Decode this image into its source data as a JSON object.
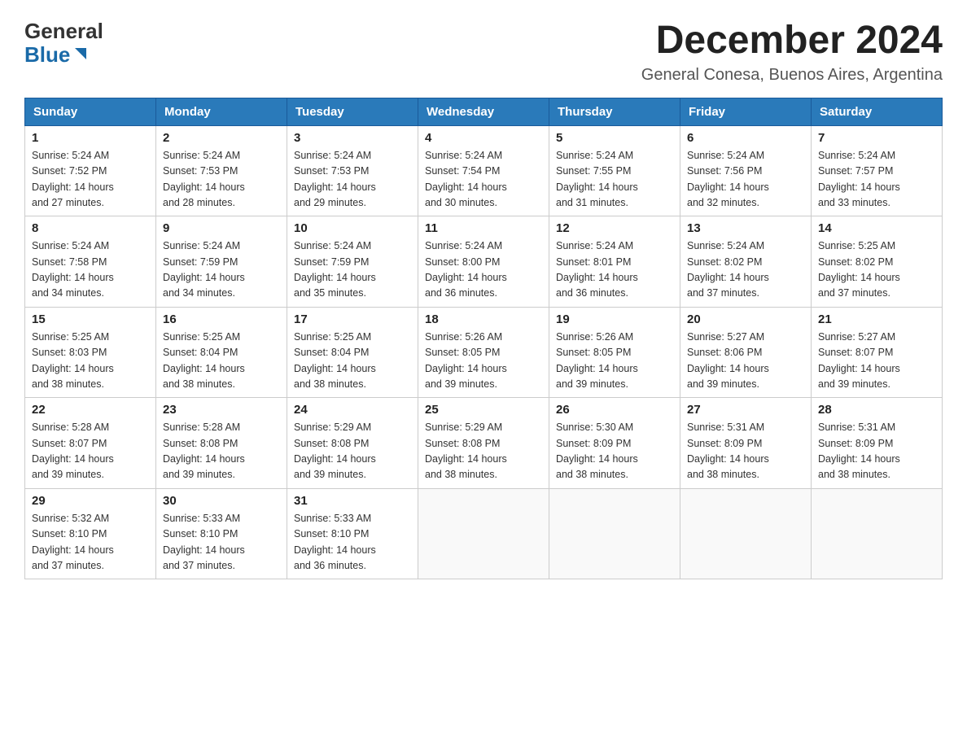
{
  "logo": {
    "general": "General",
    "blue": "Blue"
  },
  "header": {
    "month_year": "December 2024",
    "location": "General Conesa, Buenos Aires, Argentina"
  },
  "days_of_week": [
    "Sunday",
    "Monday",
    "Tuesday",
    "Wednesday",
    "Thursday",
    "Friday",
    "Saturday"
  ],
  "weeks": [
    [
      {
        "day": "1",
        "sunrise": "5:24 AM",
        "sunset": "7:52 PM",
        "daylight": "14 hours and 27 minutes."
      },
      {
        "day": "2",
        "sunrise": "5:24 AM",
        "sunset": "7:53 PM",
        "daylight": "14 hours and 28 minutes."
      },
      {
        "day": "3",
        "sunrise": "5:24 AM",
        "sunset": "7:53 PM",
        "daylight": "14 hours and 29 minutes."
      },
      {
        "day": "4",
        "sunrise": "5:24 AM",
        "sunset": "7:54 PM",
        "daylight": "14 hours and 30 minutes."
      },
      {
        "day": "5",
        "sunrise": "5:24 AM",
        "sunset": "7:55 PM",
        "daylight": "14 hours and 31 minutes."
      },
      {
        "day": "6",
        "sunrise": "5:24 AM",
        "sunset": "7:56 PM",
        "daylight": "14 hours and 32 minutes."
      },
      {
        "day": "7",
        "sunrise": "5:24 AM",
        "sunset": "7:57 PM",
        "daylight": "14 hours and 33 minutes."
      }
    ],
    [
      {
        "day": "8",
        "sunrise": "5:24 AM",
        "sunset": "7:58 PM",
        "daylight": "14 hours and 34 minutes."
      },
      {
        "day": "9",
        "sunrise": "5:24 AM",
        "sunset": "7:59 PM",
        "daylight": "14 hours and 34 minutes."
      },
      {
        "day": "10",
        "sunrise": "5:24 AM",
        "sunset": "7:59 PM",
        "daylight": "14 hours and 35 minutes."
      },
      {
        "day": "11",
        "sunrise": "5:24 AM",
        "sunset": "8:00 PM",
        "daylight": "14 hours and 36 minutes."
      },
      {
        "day": "12",
        "sunrise": "5:24 AM",
        "sunset": "8:01 PM",
        "daylight": "14 hours and 36 minutes."
      },
      {
        "day": "13",
        "sunrise": "5:24 AM",
        "sunset": "8:02 PM",
        "daylight": "14 hours and 37 minutes."
      },
      {
        "day": "14",
        "sunrise": "5:25 AM",
        "sunset": "8:02 PM",
        "daylight": "14 hours and 37 minutes."
      }
    ],
    [
      {
        "day": "15",
        "sunrise": "5:25 AM",
        "sunset": "8:03 PM",
        "daylight": "14 hours and 38 minutes."
      },
      {
        "day": "16",
        "sunrise": "5:25 AM",
        "sunset": "8:04 PM",
        "daylight": "14 hours and 38 minutes."
      },
      {
        "day": "17",
        "sunrise": "5:25 AM",
        "sunset": "8:04 PM",
        "daylight": "14 hours and 38 minutes."
      },
      {
        "day": "18",
        "sunrise": "5:26 AM",
        "sunset": "8:05 PM",
        "daylight": "14 hours and 39 minutes."
      },
      {
        "day": "19",
        "sunrise": "5:26 AM",
        "sunset": "8:05 PM",
        "daylight": "14 hours and 39 minutes."
      },
      {
        "day": "20",
        "sunrise": "5:27 AM",
        "sunset": "8:06 PM",
        "daylight": "14 hours and 39 minutes."
      },
      {
        "day": "21",
        "sunrise": "5:27 AM",
        "sunset": "8:07 PM",
        "daylight": "14 hours and 39 minutes."
      }
    ],
    [
      {
        "day": "22",
        "sunrise": "5:28 AM",
        "sunset": "8:07 PM",
        "daylight": "14 hours and 39 minutes."
      },
      {
        "day": "23",
        "sunrise": "5:28 AM",
        "sunset": "8:08 PM",
        "daylight": "14 hours and 39 minutes."
      },
      {
        "day": "24",
        "sunrise": "5:29 AM",
        "sunset": "8:08 PM",
        "daylight": "14 hours and 39 minutes."
      },
      {
        "day": "25",
        "sunrise": "5:29 AM",
        "sunset": "8:08 PM",
        "daylight": "14 hours and 38 minutes."
      },
      {
        "day": "26",
        "sunrise": "5:30 AM",
        "sunset": "8:09 PM",
        "daylight": "14 hours and 38 minutes."
      },
      {
        "day": "27",
        "sunrise": "5:31 AM",
        "sunset": "8:09 PM",
        "daylight": "14 hours and 38 minutes."
      },
      {
        "day": "28",
        "sunrise": "5:31 AM",
        "sunset": "8:09 PM",
        "daylight": "14 hours and 38 minutes."
      }
    ],
    [
      {
        "day": "29",
        "sunrise": "5:32 AM",
        "sunset": "8:10 PM",
        "daylight": "14 hours and 37 minutes."
      },
      {
        "day": "30",
        "sunrise": "5:33 AM",
        "sunset": "8:10 PM",
        "daylight": "14 hours and 37 minutes."
      },
      {
        "day": "31",
        "sunrise": "5:33 AM",
        "sunset": "8:10 PM",
        "daylight": "14 hours and 36 minutes."
      },
      null,
      null,
      null,
      null
    ]
  ],
  "labels": {
    "sunrise": "Sunrise:",
    "sunset": "Sunset:",
    "daylight": "Daylight:"
  }
}
